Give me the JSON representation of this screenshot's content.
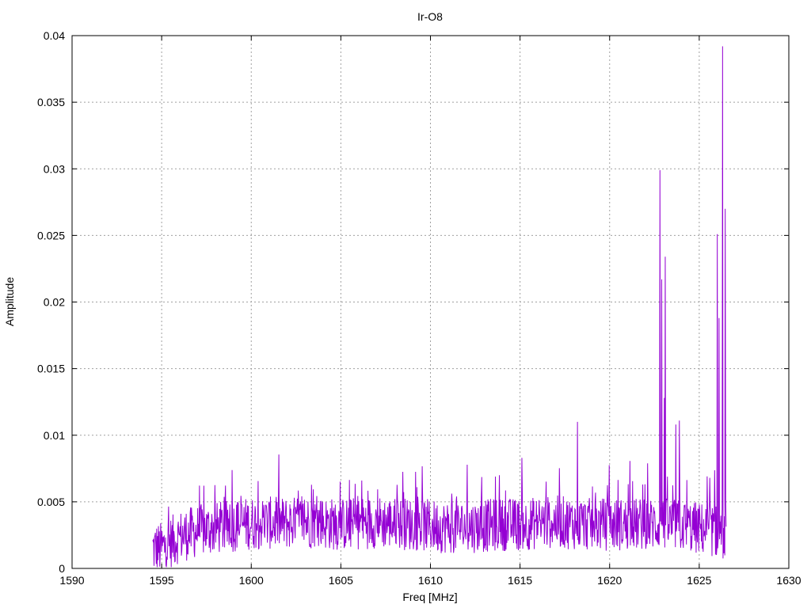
{
  "chart_data": {
    "type": "line",
    "title": "Ir-O8",
    "xlabel": "Freq [MHz]",
    "ylabel": "Amplitude",
    "xlim": [
      1590,
      1630
    ],
    "ylim": [
      0,
      0.04
    ],
    "x_ticks": [
      1590,
      1595,
      1600,
      1605,
      1610,
      1615,
      1620,
      1625,
      1630
    ],
    "x_tick_labels": [
      "1590",
      "1595",
      "1600",
      "1605",
      "1610",
      "1615",
      "1620",
      "1625",
      "1630"
    ],
    "y_ticks": [
      0,
      0.005,
      0.01,
      0.015,
      0.02,
      0.025,
      0.03,
      0.035,
      0.04
    ],
    "y_tick_labels": [
      "0",
      "0.005",
      "0.01",
      "0.015",
      "0.02",
      "0.025",
      "0.03",
      "0.035",
      "0.04"
    ],
    "grid": true,
    "series": [
      {
        "color": "#9400d3",
        "x_start": 1594.5,
        "x_end": 1626.5,
        "baseline_points": [
          [
            1594.5,
            0.0015
          ],
          [
            1595,
            0.0015
          ],
          [
            1596,
            0.0024
          ],
          [
            1597,
            0.0028
          ],
          [
            1598,
            0.003
          ],
          [
            1599,
            0.0032
          ],
          [
            1600,
            0.0034
          ],
          [
            1601,
            0.0034
          ],
          [
            1602,
            0.0034
          ],
          [
            1603,
            0.0035
          ],
          [
            1604,
            0.0034
          ],
          [
            1605,
            0.0033
          ],
          [
            1606,
            0.0034
          ],
          [
            1607,
            0.0035
          ],
          [
            1608,
            0.0034
          ],
          [
            1609,
            0.0033
          ],
          [
            1610,
            0.0032
          ],
          [
            1611,
            0.0031
          ],
          [
            1612,
            0.0031
          ],
          [
            1613,
            0.0032
          ],
          [
            1614,
            0.0033
          ],
          [
            1615,
            0.0033
          ],
          [
            1616,
            0.0034
          ],
          [
            1617,
            0.0035
          ],
          [
            1618,
            0.0034
          ],
          [
            1619,
            0.0033
          ],
          [
            1620,
            0.0033
          ],
          [
            1621,
            0.0033
          ],
          [
            1622,
            0.0033
          ],
          [
            1623,
            0.0033
          ],
          [
            1624,
            0.0032
          ],
          [
            1625,
            0.003
          ],
          [
            1626,
            0.0028
          ],
          [
            1626.5,
            0.0025
          ]
        ],
        "noise_amplitude": 0.002,
        "peaks": [
          [
            1618.2,
            0.011
          ],
          [
            1622.8,
            0.0299
          ],
          [
            1622.9,
            0.0217
          ],
          [
            1623.1,
            0.0234
          ],
          [
            1623.05,
            0.0128
          ],
          [
            1623.7,
            0.0108
          ],
          [
            1623.9,
            0.0111
          ],
          [
            1626.0,
            0.0251
          ],
          [
            1626.1,
            0.0188
          ],
          [
            1626.3,
            0.0392
          ],
          [
            1626.45,
            0.027
          ]
        ]
      }
    ]
  }
}
